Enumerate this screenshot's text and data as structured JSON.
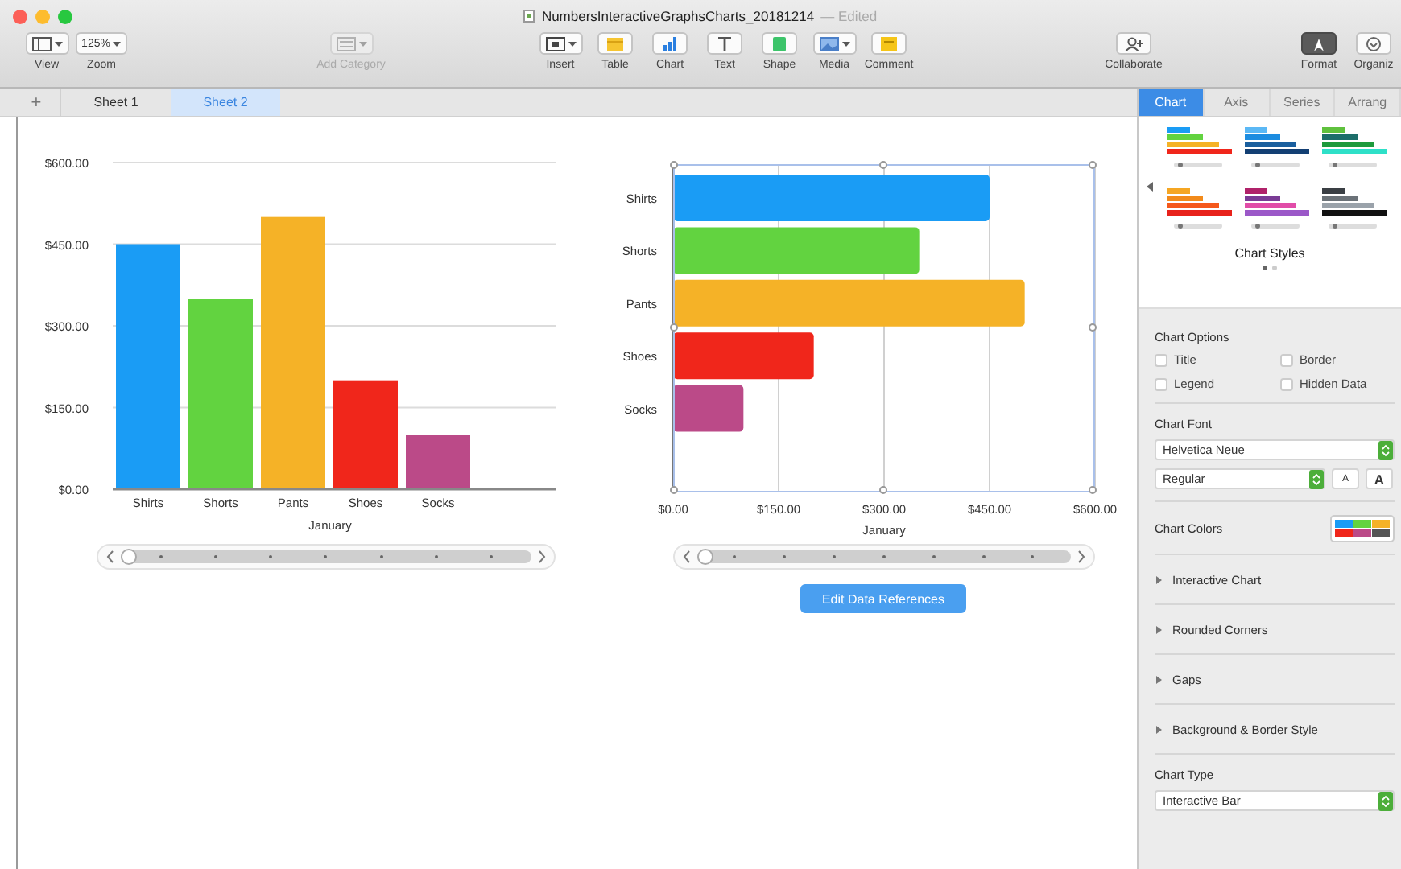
{
  "window": {
    "title": "NumbersInteractiveGraphsCharts_20181214",
    "status": "— Edited"
  },
  "toolbar": [
    {
      "kind": "view",
      "label": "View",
      "selected": false,
      "disabled": false
    },
    {
      "kind": "zoom",
      "label": "Zoom",
      "value": "125%",
      "selected": false,
      "disabled": false
    },
    {
      "kind": "add_category",
      "label": "Add Category",
      "selected": false,
      "disabled": true
    },
    {
      "kind": "insert",
      "label": "Insert",
      "selected": false,
      "disabled": false
    },
    {
      "kind": "table",
      "label": "Table",
      "selected": false,
      "disabled": false
    },
    {
      "kind": "chart",
      "label": "Chart",
      "selected": false,
      "disabled": false
    },
    {
      "kind": "text",
      "label": "Text",
      "selected": false,
      "disabled": false
    },
    {
      "kind": "shape",
      "label": "Shape",
      "selected": false,
      "disabled": false
    },
    {
      "kind": "media",
      "label": "Media",
      "selected": false,
      "disabled": false
    },
    {
      "kind": "comment",
      "label": "Comment",
      "selected": false,
      "disabled": false
    },
    {
      "kind": "collaborate",
      "label": "Collaborate",
      "selected": false,
      "disabled": false
    },
    {
      "kind": "format",
      "label": "Format",
      "selected": true,
      "disabled": false
    },
    {
      "kind": "organize",
      "label": "Organiz",
      "selected": false,
      "disabled": false
    }
  ],
  "add_sheet": "+",
  "sheet_tabs": [
    {
      "label": "Sheet 1",
      "selected": false
    },
    {
      "label": "Sheet 2",
      "selected": true
    }
  ],
  "charts": [
    {
      "slider": {
        "level": 0
      },
      "chart_data": {
        "type": "bar",
        "orientation": "vertical",
        "grid": true,
        "xlabel": "January",
        "categories": [
          "Shirts",
          "Shorts",
          "Pants",
          "Shoes",
          "Socks"
        ],
        "values": [
          450,
          350,
          500,
          200,
          100
        ],
        "ylim": [
          0,
          600
        ],
        "yticks": [
          {
            "value": 0,
            "label": "$0.00"
          },
          {
            "value": 150,
            "label": "$150.00"
          },
          {
            "value": 300,
            "label": "$300.00"
          },
          {
            "value": 450,
            "label": "$450.00"
          },
          {
            "value": 600,
            "label": "$600.00"
          }
        ]
      }
    },
    {
      "selected": true,
      "slider": {
        "level": 0
      },
      "button": "Edit Data References",
      "chart_data": {
        "type": "bar",
        "orientation": "horizontal",
        "grid": true,
        "xlabel": "January",
        "categories": [
          "Shirts",
          "Shorts",
          "Pants",
          "Shoes",
          "Socks"
        ],
        "values": [
          450,
          350,
          500,
          200,
          100
        ],
        "xlim": [
          0,
          600
        ],
        "xticks": [
          {
            "value": 0,
            "label": "$0.00"
          },
          {
            "value": 150,
            "label": "$150.00"
          },
          {
            "value": 300,
            "label": "$300.00"
          },
          {
            "value": 450,
            "label": "$450.00"
          },
          {
            "value": 600,
            "label": "$600.00"
          }
        ]
      }
    }
  ],
  "inspector": {
    "tabs": [
      {
        "label": "Chart",
        "selected": true
      },
      {
        "label": "Axis",
        "selected": false
      },
      {
        "label": "Series",
        "selected": false
      },
      {
        "label": "Arrang",
        "selected": false
      }
    ],
    "chart_styles": {
      "label": "Chart Styles",
      "pages": [
        {
          "selected": true
        },
        {
          "selected": false
        }
      ]
    },
    "chart_options": {
      "title": "Chart Options",
      "checkboxes": [
        {
          "label": "Title",
          "checked": false
        },
        {
          "label": "Border",
          "checked": false
        },
        {
          "label": "Legend",
          "checked": false
        },
        {
          "label": "Hidden Data",
          "checked": false
        }
      ]
    },
    "chart_font": {
      "title": "Chart Font",
      "family": "Helvetica Neue",
      "style": "Regular",
      "smaller": "A",
      "larger": "A"
    },
    "chart_colors": {
      "label": "Chart Colors"
    },
    "sections": [
      {
        "label": "Interactive Chart",
        "expanded": false
      },
      {
        "label": "Rounded Corners",
        "expanded": false
      },
      {
        "label": "Gaps",
        "expanded": false
      },
      {
        "label": "Background & Border Style",
        "expanded": false
      }
    ],
    "chart_type": {
      "title": "Chart Type",
      "value": "Interactive Bar"
    }
  }
}
